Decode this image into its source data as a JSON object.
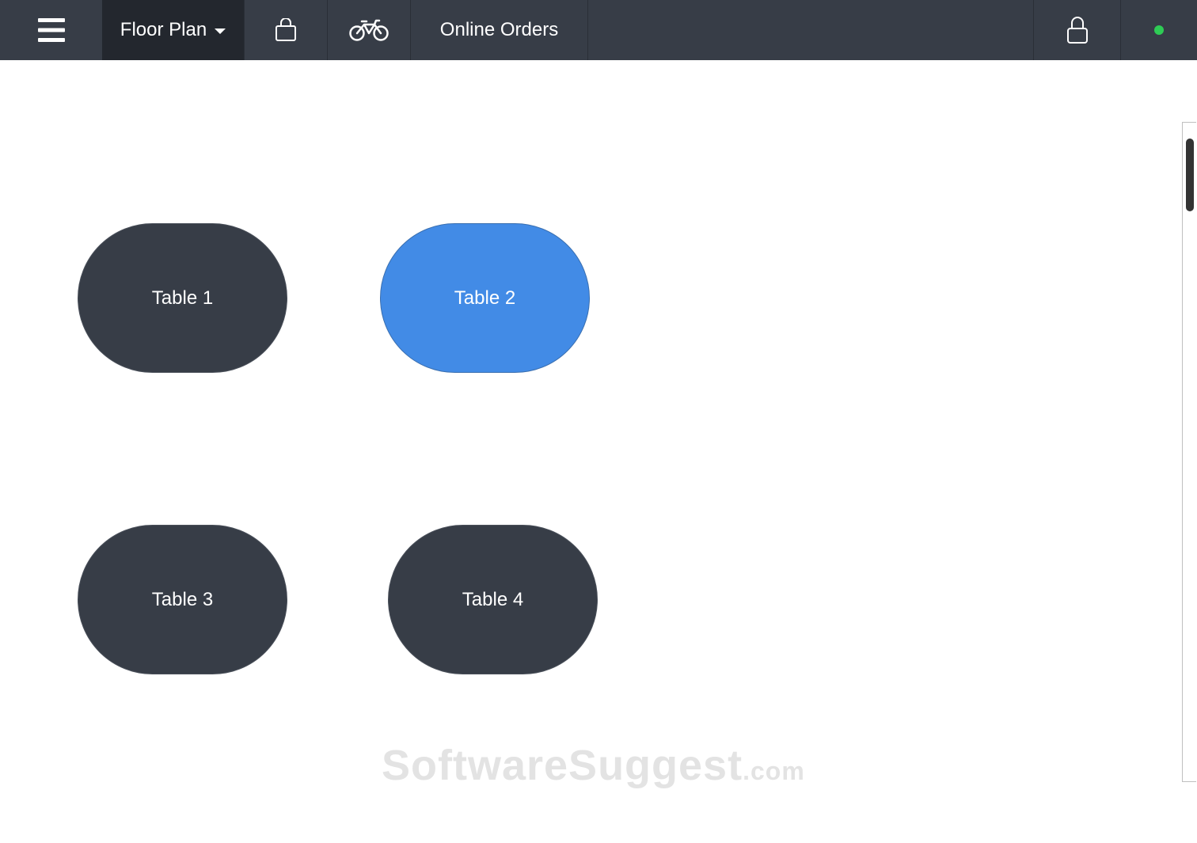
{
  "toolbar": {
    "menu_icon": "hamburger-menu-icon",
    "floor_plan_label": "Floor Plan",
    "bag_icon": "shopping-bag-icon",
    "bike_icon": "bicycle-icon",
    "online_orders_label": "Online Orders",
    "lock_icon": "lock-icon",
    "status_color": "#2ecc55"
  },
  "tables": [
    {
      "label": "Table 1",
      "selected": false
    },
    {
      "label": "Table 2",
      "selected": true
    },
    {
      "label": "Table 3",
      "selected": false
    },
    {
      "label": "Table 4",
      "selected": false
    }
  ],
  "colors": {
    "toolbar_bg": "#373d47",
    "active_tab_bg": "#23272e",
    "table_bg": "#373d47",
    "table_selected_bg": "#428be6"
  },
  "watermark": {
    "main": "SoftwareSuggest",
    "suffix": ".com"
  }
}
